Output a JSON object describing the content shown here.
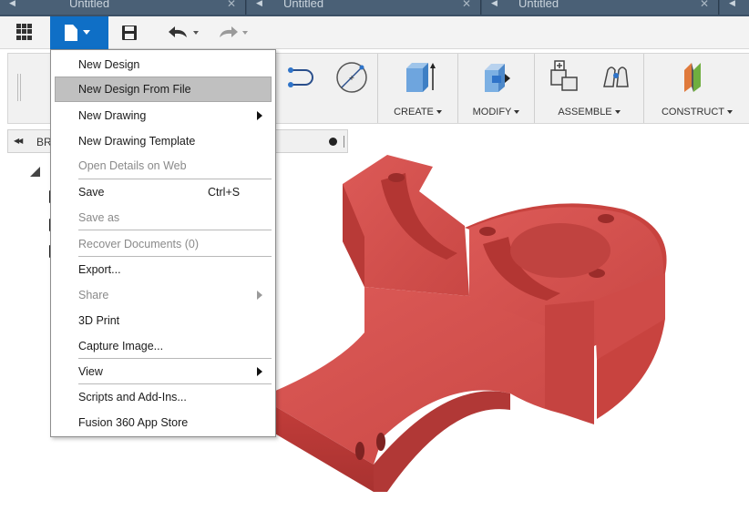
{
  "tabs": [
    {
      "title": "Untitled"
    },
    {
      "title": "Untitled"
    },
    {
      "title": "Untitled"
    }
  ],
  "toolbar": {
    "grid_icon": "app-grid-icon",
    "file_icon": "document-icon",
    "save_icon": "floppy-save-icon",
    "undo_icon": "undo-arrow-icon",
    "redo_icon": "redo-arrow-icon",
    "accent": "#0f6fc6"
  },
  "ribbon": {
    "groups": [
      {
        "label": "CREATE"
      },
      {
        "label": "MODIFY"
      },
      {
        "label": "ASSEMBLE"
      },
      {
        "label": "CONSTRUCT"
      }
    ]
  },
  "browser": {
    "label": "BR"
  },
  "file_menu": {
    "items": [
      {
        "label": "New Design",
        "disabled": false
      },
      {
        "label": "New Design From File",
        "selected": true
      },
      {
        "label": "New Drawing",
        "submenu": true
      },
      {
        "label": "New Drawing Template"
      },
      {
        "label": "Open Details on Web",
        "disabled": true
      },
      {
        "label": "Save",
        "shortcut": "Ctrl+S"
      },
      {
        "label": "Save as",
        "disabled": true
      },
      {
        "label": "Recover Documents (0)",
        "disabled": true
      },
      {
        "label": "Export..."
      },
      {
        "label": "Share",
        "disabled": true,
        "submenu": true
      },
      {
        "label": "3D Print"
      },
      {
        "label": "Capture Image..."
      },
      {
        "label": "View",
        "submenu": true
      },
      {
        "label": "Scripts and Add-Ins..."
      },
      {
        "label": "Fusion 360 App Store"
      }
    ]
  },
  "model": {
    "color": "#d8504e"
  }
}
